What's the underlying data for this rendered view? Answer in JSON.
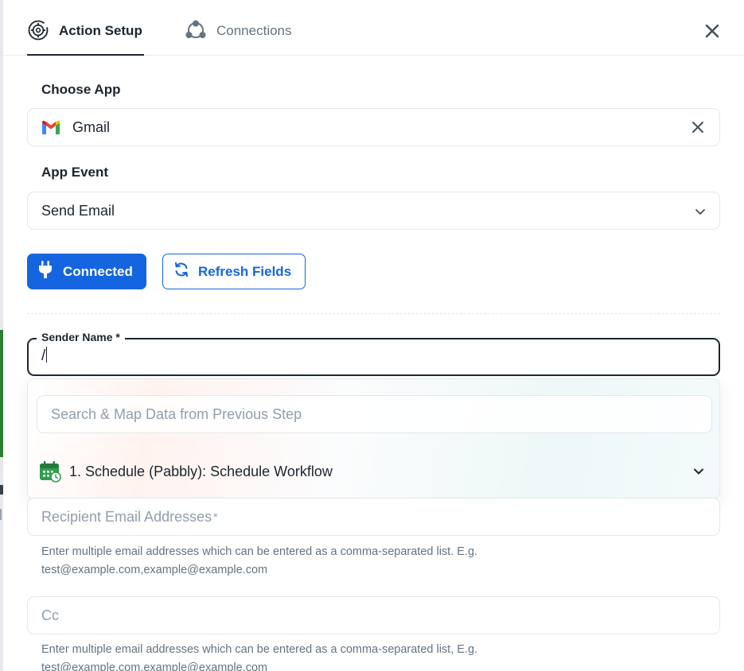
{
  "tabs": {
    "action_setup": "Action Setup",
    "connections": "Connections"
  },
  "choose_app": {
    "label": "Choose App",
    "value": "Gmail"
  },
  "app_event": {
    "label": "App Event",
    "value": "Send Email"
  },
  "buttons": {
    "connected": "Connected",
    "refresh": "Refresh Fields"
  },
  "sender_name": {
    "label": "Sender Name *",
    "value": "/"
  },
  "map_dropdown": {
    "search_placeholder": "Search & Map Data from Previous Step",
    "step": "1. Schedule (Pabbly): Schedule Workflow"
  },
  "recipient": {
    "placeholder": "Recipient Email Addresses",
    "required_mark": "*",
    "help_line1": "Enter multiple email addresses which can be entered as a comma-separated list. E.g.",
    "help_line2": "test@example.com,example@example.com"
  },
  "cc": {
    "placeholder": "Cc",
    "help_line1": "Enter multiple email addresses which can be entered as a comma-separated list, E.g.",
    "help_line2": "test@example.com,example@example.com"
  },
  "colors": {
    "primary": "#1565e0",
    "text": "#1c252e",
    "muted": "#637381",
    "placeholder": "#919eab",
    "calendar_green": "#2e9e4f"
  }
}
